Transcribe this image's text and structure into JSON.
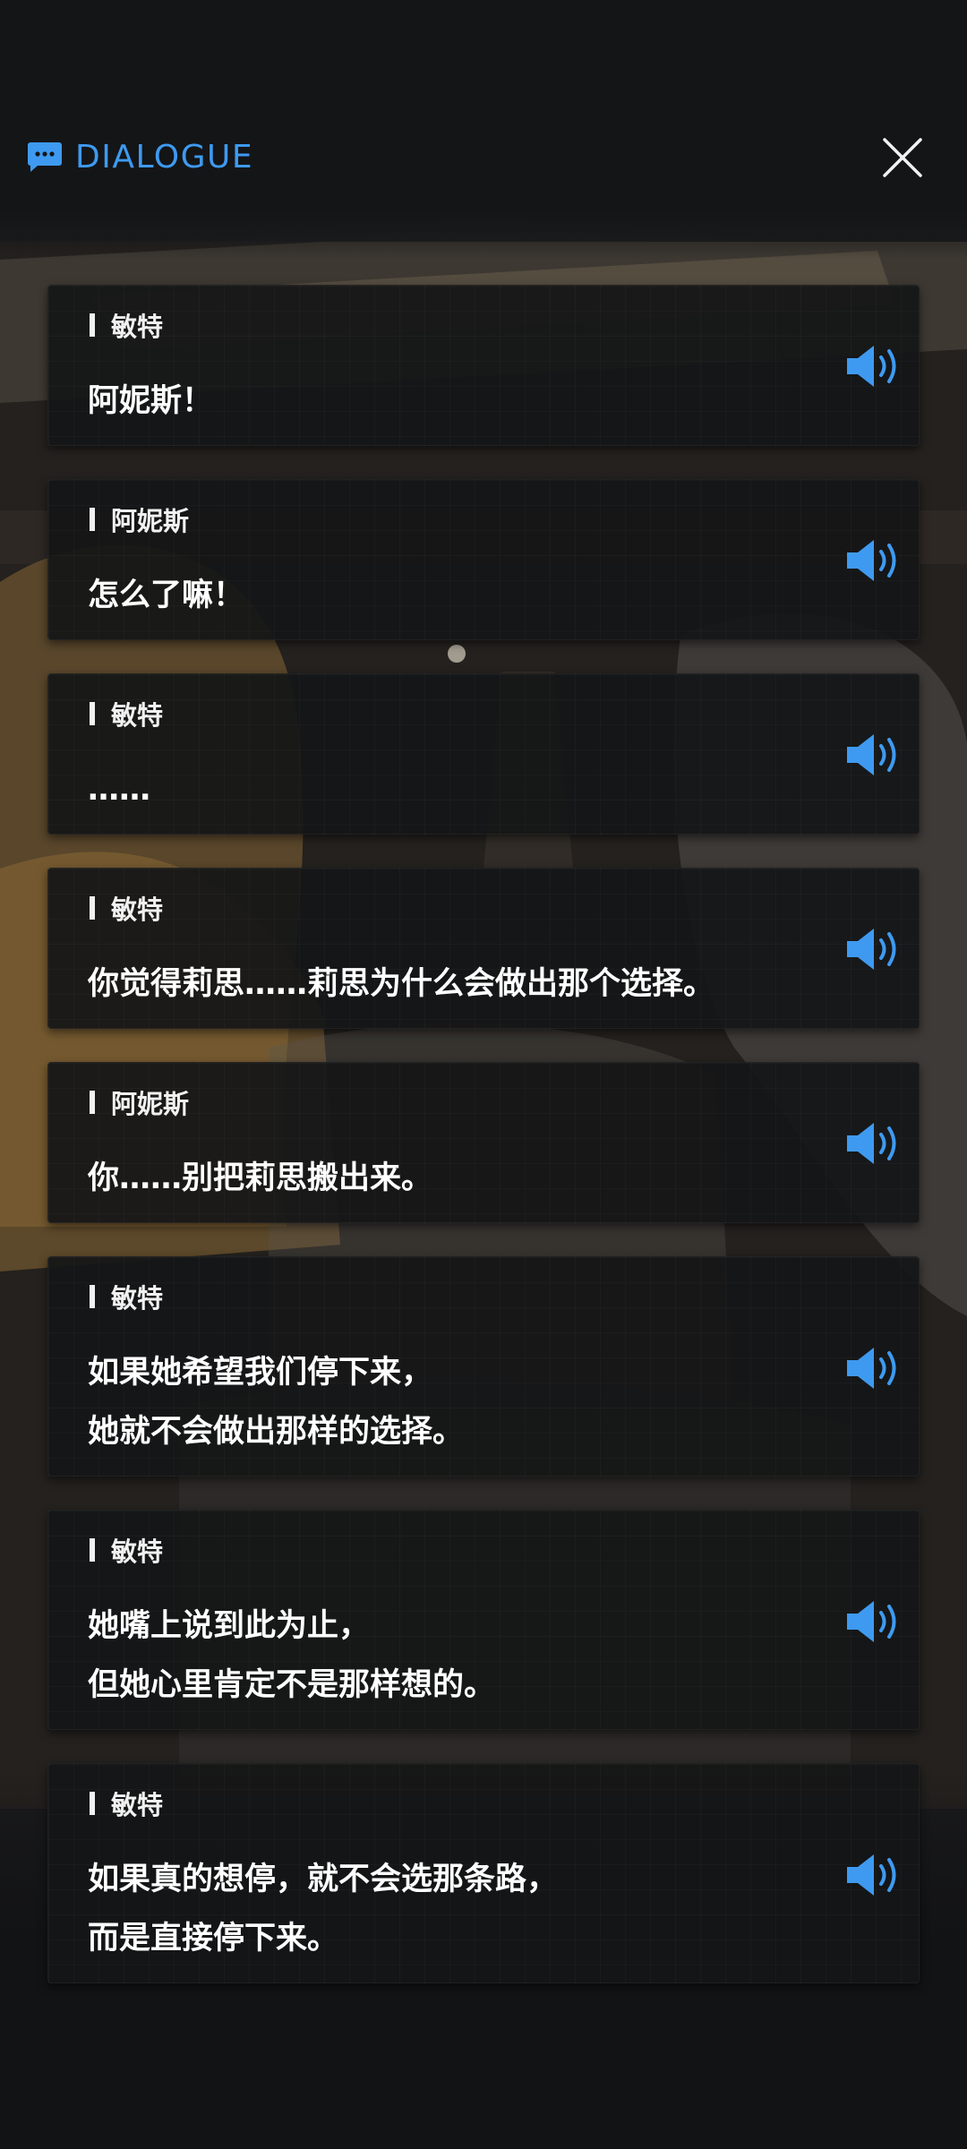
{
  "header": {
    "title": "DIALOGUE",
    "accent_color": "#3e9af0",
    "chat_icon": "chat-bubble-icon",
    "close_icon": "close-icon"
  },
  "entries": [
    {
      "speaker": "敏特",
      "lines": [
        "阿妮斯！"
      ]
    },
    {
      "speaker": "阿妮斯",
      "lines": [
        "怎么了嘛！"
      ]
    },
    {
      "speaker": "敏特",
      "lines": [
        "……"
      ]
    },
    {
      "speaker": "敏特",
      "lines": [
        "你觉得莉思……莉思为什么会做出那个选择。"
      ]
    },
    {
      "speaker": "阿妮斯",
      "lines": [
        "你……别把莉思搬出来。"
      ]
    },
    {
      "speaker": "敏特",
      "lines": [
        "如果她希望我们停下来，",
        "她就不会做出那样的选择。"
      ]
    },
    {
      "speaker": "敏特",
      "lines": [
        "她嘴上说到此为止，",
        "但她心里肯定不是那样想的。"
      ]
    },
    {
      "speaker": "敏特",
      "lines": [
        "如果真的想停，就不会选那条路，",
        "而是直接停下来。"
      ]
    }
  ],
  "voice_icon": "speaker-volume-icon",
  "voice_color": "#3e9af0"
}
